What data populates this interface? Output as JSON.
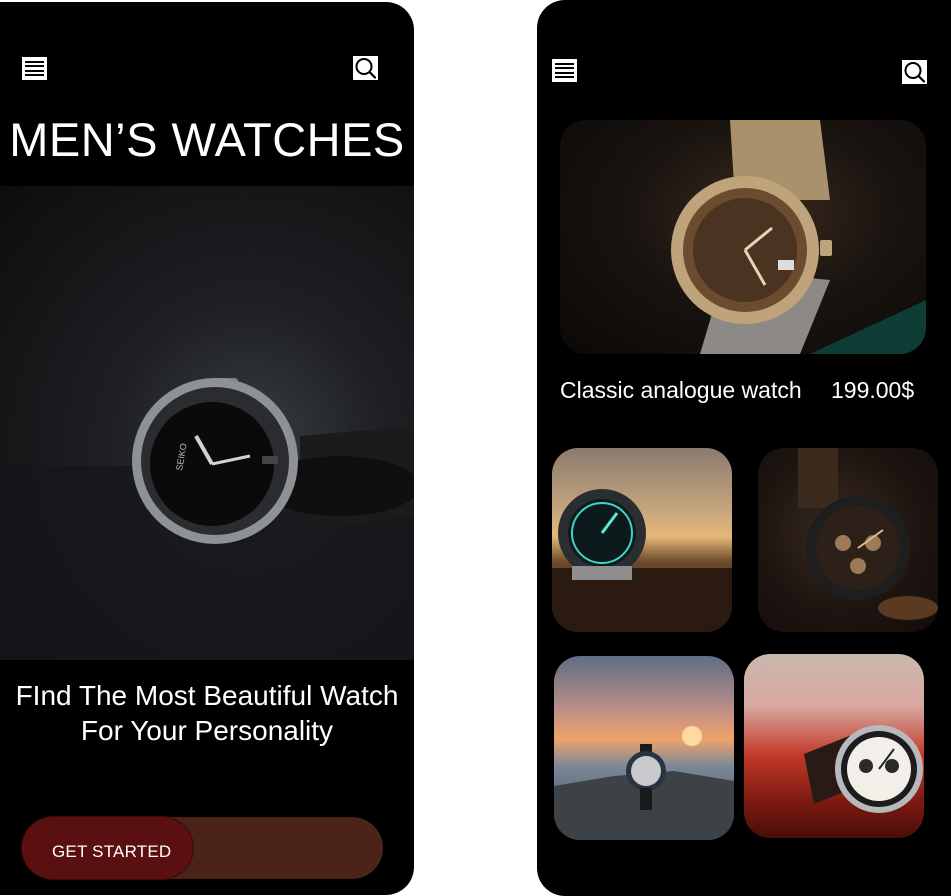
{
  "screen1": {
    "title": "MEN’S  WATCHES",
    "tagline_line1": "FInd The Most Beautiful Watch",
    "tagline_line2": "For Your Personality",
    "cta_label": "GET STARTED",
    "hero_watch_brand": "SEIKO"
  },
  "screen2": {
    "featured": {
      "name": "Classic analogue watch",
      "price": "199.00$"
    }
  },
  "icons": {
    "menu": "hamburger-menu-icon",
    "search": "search-icon"
  },
  "colors": {
    "background": "#000000",
    "cta_track": "#4a2418",
    "cta_knob": "#5a0f10",
    "text": "#ffffff"
  }
}
